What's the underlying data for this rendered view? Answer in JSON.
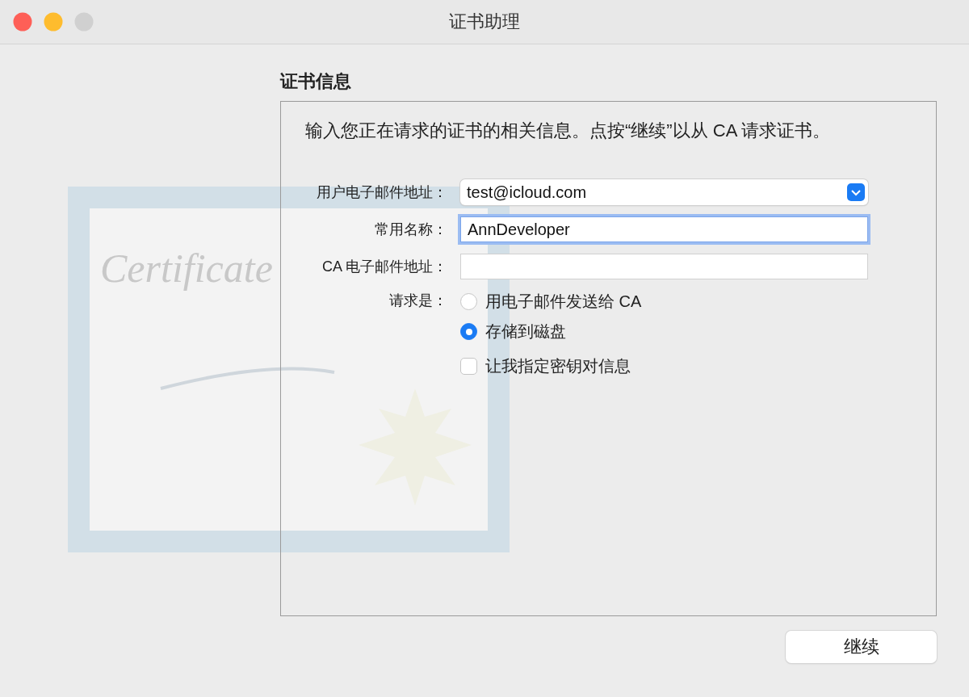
{
  "window": {
    "title": "证书助理"
  },
  "heading": "证书信息",
  "artwork": {
    "text": "Certificate"
  },
  "description": "输入您正在请求的证书的相关信息。点按“继续”以从 CA 请求证书。",
  "fields": [
    {
      "kind": "select",
      "label": "用户电子邮件地址：",
      "value": "test@icloud.com"
    },
    {
      "kind": "text",
      "label": "常用名称：",
      "value": "AnnDeveloper",
      "focused": true
    },
    {
      "kind": "text",
      "label": "CA 电子邮件地址：",
      "focused": false
    }
  ],
  "request": {
    "label": "请求是：",
    "options": [
      {
        "label": "用电子邮件发送给 CA",
        "selected": false
      },
      {
        "label": "存储到磁盘",
        "selected": true
      }
    ]
  },
  "checkbox": {
    "label": "让我指定密钥对信息",
    "checked": false
  },
  "buttons": [
    {
      "label": "继续"
    }
  ]
}
